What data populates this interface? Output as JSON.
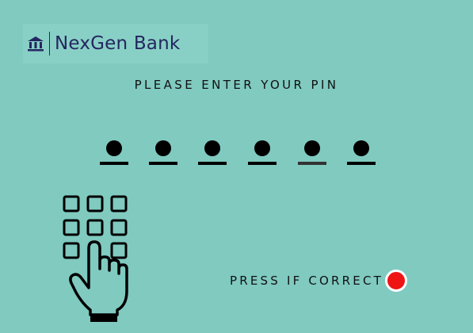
{
  "brand": {
    "name": "NexGen Bank",
    "icon": "bank-icon"
  },
  "prompt": "PLEASE ENTER YOUR PIN",
  "pin": {
    "digit_count": 6,
    "entered_count": 6
  },
  "keypad": {
    "icon": "keypad-hand-icon"
  },
  "confirm": {
    "label": "PRESS IF CORRECT",
    "button_color": "#ef1414"
  },
  "colors": {
    "background": "#80cac0",
    "brand_text": "#252560"
  }
}
